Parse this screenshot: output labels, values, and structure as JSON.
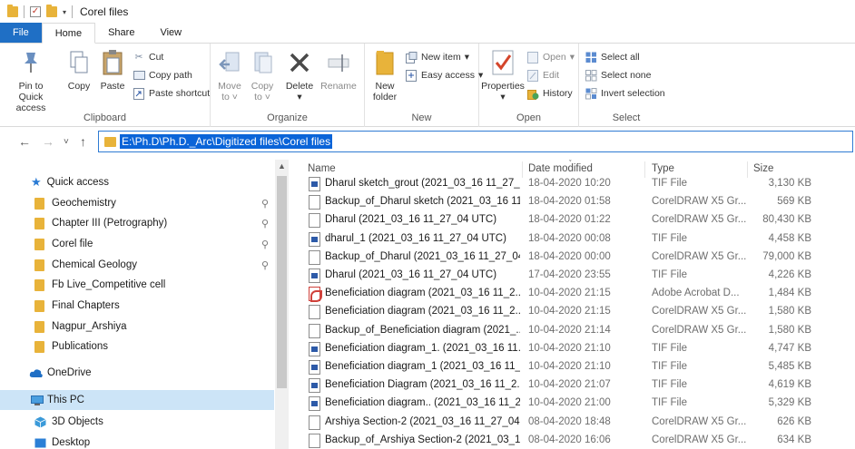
{
  "window": {
    "title": "Corel files"
  },
  "tabs": [
    "File",
    "Home",
    "Share",
    "View"
  ],
  "ribbon": {
    "clipboard": {
      "label": "Clipboard",
      "pin_to_quick_access_line1": "Pin to Quick",
      "pin_to_quick_access_line2": "access",
      "copy": "Copy",
      "paste": "Paste",
      "cut": "Cut",
      "copy_path": "Copy path",
      "paste_shortcut": "Paste shortcut"
    },
    "organize": {
      "label": "Organize",
      "move_to_line1": "Move",
      "move_to_line2": "to",
      "copy_to_line1": "Copy",
      "copy_to_line2": "to",
      "delete": "Delete",
      "rename": "Rename"
    },
    "new": {
      "label": "New",
      "new_folder_line1": "New",
      "new_folder_line2": "folder",
      "new_item": "New item",
      "easy_access": "Easy access"
    },
    "open": {
      "label": "Open",
      "properties": "Properties",
      "open": "Open",
      "edit": "Edit",
      "history": "History"
    },
    "select": {
      "label": "Select",
      "select_all": "Select all",
      "select_none": "Select none",
      "invert_selection": "Invert selection"
    }
  },
  "address": {
    "path": "E:\\Ph.D\\Ph.D._Arc\\Digitized files\\Corel files"
  },
  "nav": {
    "quick_access": "Quick access",
    "quick_items": [
      {
        "label": "Geochemistry",
        "pinned": true
      },
      {
        "label": "Chapter III (Petrography)",
        "pinned": true
      },
      {
        "label": "Corel file",
        "pinned": true
      },
      {
        "label": "Chemical Geology",
        "pinned": true
      },
      {
        "label": "Fb Live_Competitive cell",
        "pinned": false
      },
      {
        "label": "Final Chapters",
        "pinned": false
      },
      {
        "label": "Nagpur_Arshiya",
        "pinned": false
      },
      {
        "label": "Publications",
        "pinned": false
      }
    ],
    "onedrive": "OneDrive",
    "this_pc": "This PC",
    "objects_3d": "3D Objects",
    "desktop": "Desktop"
  },
  "columns": {
    "name": "Name",
    "date": "Date modified",
    "type": "Type",
    "size": "Size"
  },
  "files": [
    {
      "name": "Dharul sketch_grout (2021_03_16 11_27_0...",
      "date": "18-04-2020 10:20",
      "type": "TIF File",
      "size": "3,130 KB",
      "icon": "tif"
    },
    {
      "name": "Backup_of_Dharul sketch (2021_03_16 11...",
      "date": "18-04-2020 01:58",
      "type": "CorelDRAW X5 Gr...",
      "size": "569 KB",
      "icon": "blank"
    },
    {
      "name": "Dharul (2021_03_16 11_27_04 UTC)",
      "date": "18-04-2020 01:22",
      "type": "CorelDRAW X5 Gr...",
      "size": "80,430 KB",
      "icon": "blank"
    },
    {
      "name": "dharul_1 (2021_03_16 11_27_04 UTC)",
      "date": "18-04-2020 00:08",
      "type": "TIF File",
      "size": "4,458 KB",
      "icon": "tif"
    },
    {
      "name": "Backup_of_Dharul (2021_03_16 11_27_04 ...",
      "date": "18-04-2020 00:00",
      "type": "CorelDRAW X5 Gr...",
      "size": "79,000 KB",
      "icon": "blank"
    },
    {
      "name": "Dharul (2021_03_16 11_27_04 UTC)",
      "date": "17-04-2020 23:55",
      "type": "TIF File",
      "size": "4,226 KB",
      "icon": "tif"
    },
    {
      "name": "Beneficiation diagram (2021_03_16 11_2...",
      "date": "10-04-2020 21:15",
      "type": "Adobe Acrobat D...",
      "size": "1,484 KB",
      "icon": "pdf"
    },
    {
      "name": "Beneficiation diagram (2021_03_16 11_2...",
      "date": "10-04-2020 21:15",
      "type": "CorelDRAW X5 Gr...",
      "size": "1,580 KB",
      "icon": "blank"
    },
    {
      "name": "Backup_of_Beneficiation diagram (2021_...",
      "date": "10-04-2020 21:14",
      "type": "CorelDRAW X5 Gr...",
      "size": "1,580 KB",
      "icon": "blank"
    },
    {
      "name": "Beneficiation diagram_1. (2021_03_16 11...",
      "date": "10-04-2020 21:10",
      "type": "TIF File",
      "size": "4,747 KB",
      "icon": "tif"
    },
    {
      "name": "Beneficiation diagram_1 (2021_03_16 11_...",
      "date": "10-04-2020 21:10",
      "type": "TIF File",
      "size": "5,485 KB",
      "icon": "tif"
    },
    {
      "name": "Beneficiation Diagram (2021_03_16 11_2...",
      "date": "10-04-2020 21:07",
      "type": "TIF File",
      "size": "4,619 KB",
      "icon": "tif"
    },
    {
      "name": "Beneficiation diagram.. (2021_03_16 11_2...",
      "date": "10-04-2020 21:00",
      "type": "TIF File",
      "size": "5,329 KB",
      "icon": "tif"
    },
    {
      "name": "Arshiya Section-2 (2021_03_16 11_27_04 ...",
      "date": "08-04-2020 18:48",
      "type": "CorelDRAW X5 Gr...",
      "size": "626 KB",
      "icon": "blank"
    },
    {
      "name": "Backup_of_Arshiya Section-2 (2021_03_1...",
      "date": "08-04-2020 16:06",
      "type": "CorelDRAW X5 Gr...",
      "size": "634 KB",
      "icon": "blank"
    }
  ]
}
